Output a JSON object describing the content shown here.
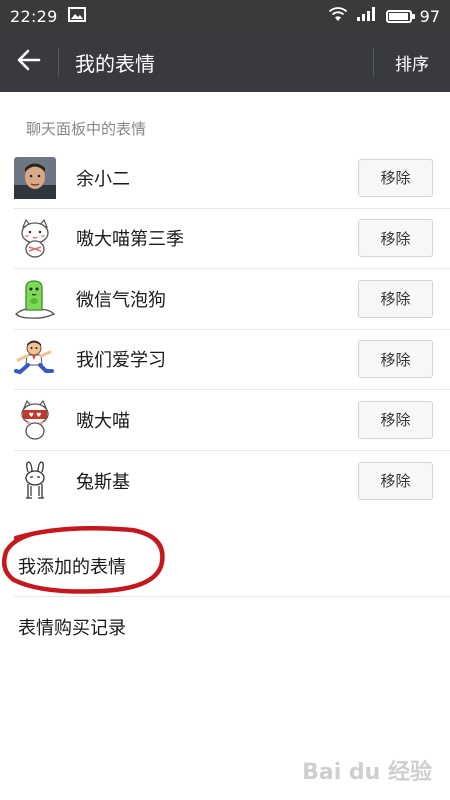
{
  "status_bar": {
    "time": "22:29",
    "battery_percent": "97",
    "battery_level": 0.97,
    "icons": [
      "image-icon",
      "wifi-icon",
      "signal-icon",
      "battery-icon"
    ]
  },
  "title_bar": {
    "title": "我的表情",
    "sort_label": "排序",
    "background": "#393a3f"
  },
  "section": {
    "header": "聊天面板中的表情"
  },
  "stickers": [
    {
      "name": "余小二",
      "thumb_icon": "person-photo-icon",
      "action": "移除"
    },
    {
      "name": "嗷大喵第三季",
      "thumb_icon": "white-cat-icon",
      "action": "移除"
    },
    {
      "name": "微信气泡狗",
      "thumb_icon": "green-dog-icon",
      "action": "移除"
    },
    {
      "name": "我们爱学习",
      "thumb_icon": "student-icon",
      "action": "移除"
    },
    {
      "name": "嗷大喵",
      "thumb_icon": "cat-holding-sign-icon",
      "action": "移除"
    },
    {
      "name": "兔斯基",
      "thumb_icon": "rabbit-icon",
      "action": "移除"
    }
  ],
  "menu": {
    "added": "我添加的表情",
    "purchase": "表情购买记录"
  },
  "watermark": "Bai du 经验"
}
